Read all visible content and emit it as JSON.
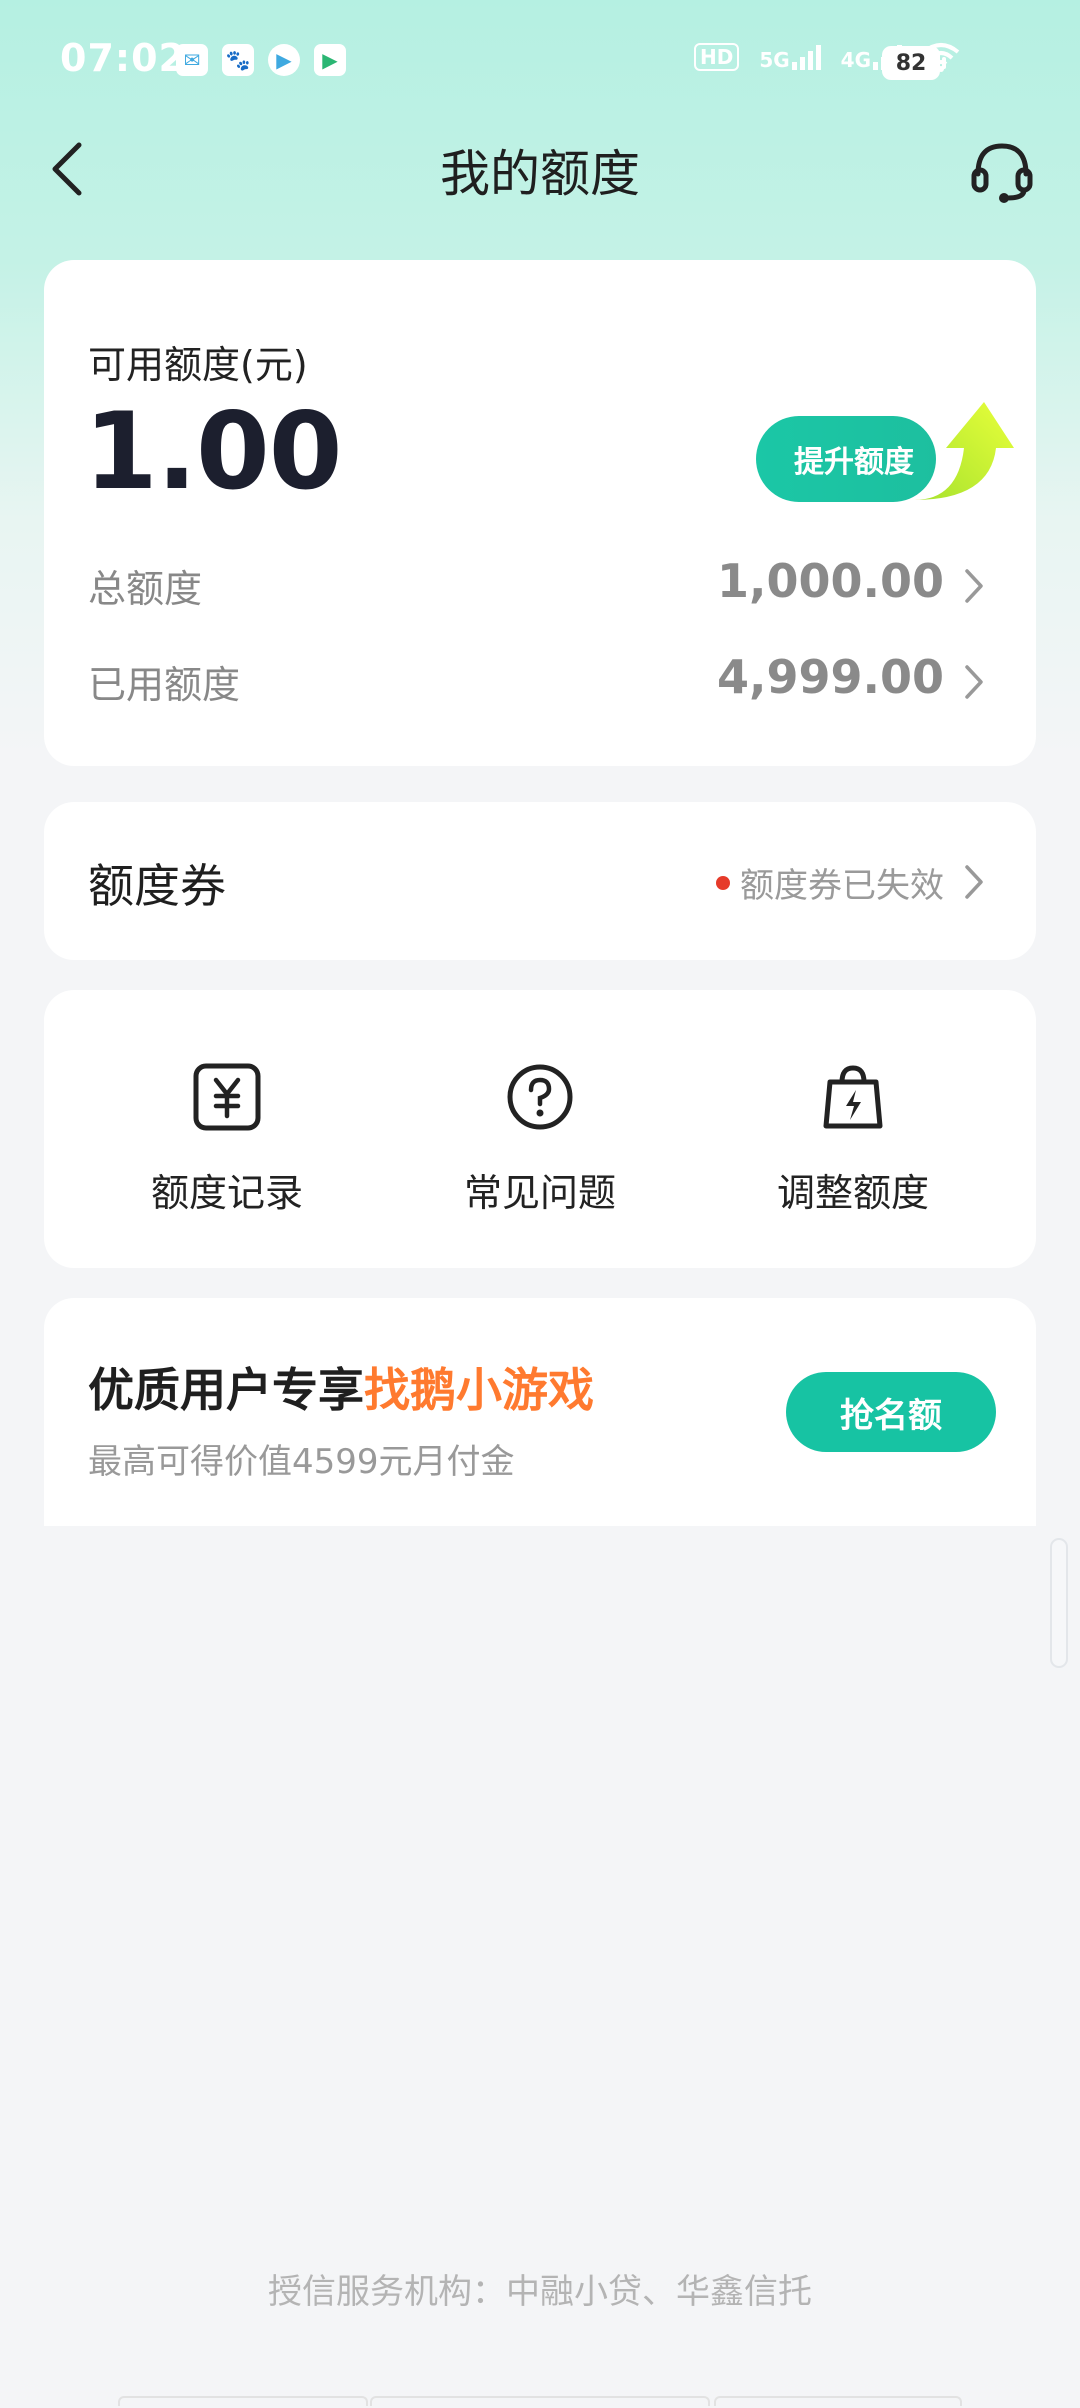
{
  "status_bar": {
    "time": "07:02",
    "hd": "HD",
    "net1": "5G",
    "net2": "4G",
    "battery": "82"
  },
  "nav": {
    "title": "我的额度"
  },
  "quota": {
    "available_label": "可用额度(元)",
    "available_value": "1.00",
    "boost_button": "提升额度",
    "total_label": "总额度",
    "total_value": "1,000.00",
    "used_label": "已用额度",
    "used_value": "4,999.00"
  },
  "coupon": {
    "title": "额度券",
    "status": "额度券已失效"
  },
  "menu": {
    "items": [
      {
        "label": "额度记录",
        "icon": "yen-note-icon"
      },
      {
        "label": "常见问题",
        "icon": "question-circle-icon"
      },
      {
        "label": "调整额度",
        "icon": "lightning-bag-icon"
      }
    ]
  },
  "promo": {
    "title_prefix": "优质用户专享",
    "title_highlight": "找鹅小游戏",
    "subtitle": "最高可得价值4599元月付金",
    "button": "抢名额"
  },
  "footer": {
    "text": "授信服务机构：中融小贷、华鑫信托"
  },
  "colors": {
    "accent": "#17c3a3",
    "highlight": "#ff7a2f",
    "alert_dot": "#e63b2a"
  }
}
